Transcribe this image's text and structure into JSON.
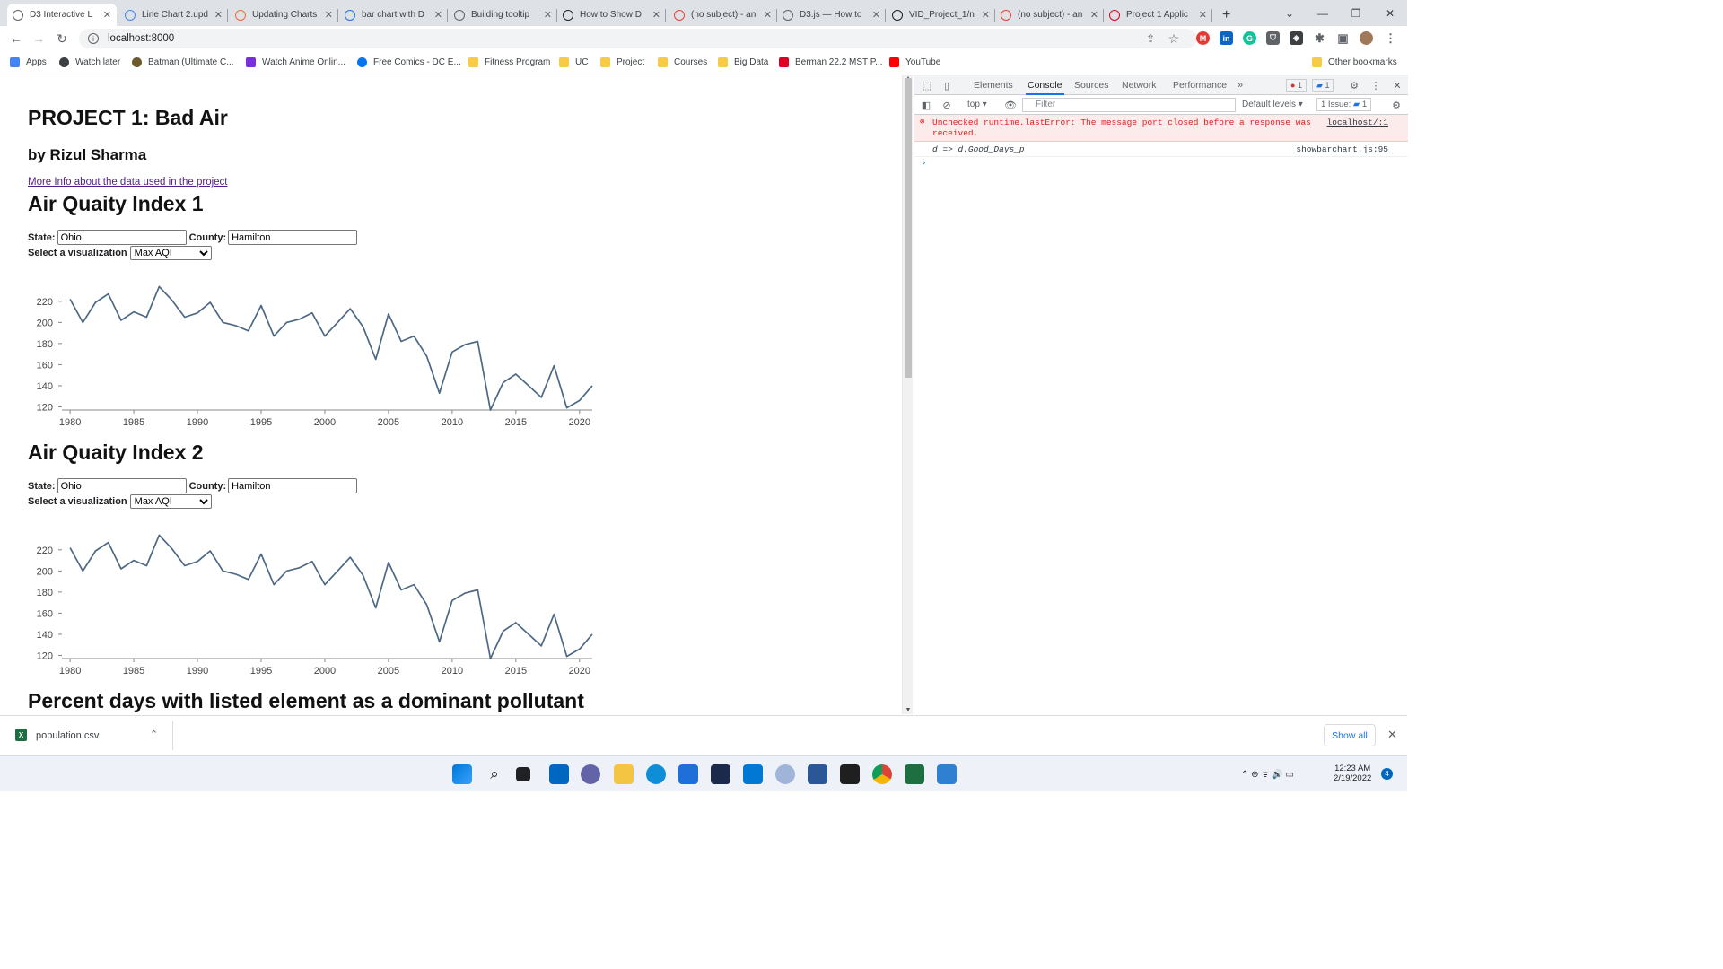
{
  "tabs": [
    {
      "title": "D3 Interactive L",
      "active": true,
      "icon": "globe-icon",
      "color": "#5f6368"
    },
    {
      "title": "Line Chart 2.upd",
      "icon": "google-icon",
      "color": "#4285f4"
    },
    {
      "title": "Updating Charts",
      "icon": "d3-icon",
      "color": "#f26b3a"
    },
    {
      "title": "bar chart with D",
      "icon": "cloud-icon",
      "color": "#1a73e8"
    },
    {
      "title": "Building tooltip",
      "icon": "tooltip-icon",
      "color": "#5f6368"
    },
    {
      "title": "How to Show D",
      "icon": "medium-icon",
      "color": "#202124"
    },
    {
      "title": "(no subject) - an",
      "icon": "gmail-icon",
      "color": "#ea4335"
    },
    {
      "title": "D3.js — How to",
      "icon": "globe-icon",
      "color": "#5f6368"
    },
    {
      "title": "VID_Project_1/n",
      "icon": "github-icon",
      "color": "#202124"
    },
    {
      "title": "(no subject) - an",
      "icon": "gmail-icon",
      "color": "#ea4335"
    },
    {
      "title": "Project 1 Applic",
      "icon": "uc-icon",
      "color": "#e00122"
    }
  ],
  "url": "localhost:8000",
  "bookmarks": [
    {
      "label": "Apps",
      "icon": "apps-icon"
    },
    {
      "label": "Watch later",
      "icon": "clock-icon"
    },
    {
      "label": "Batman (Ultimate C...",
      "icon": "batman-icon"
    },
    {
      "label": "Watch Anime Onlin...",
      "icon": "play-icon"
    },
    {
      "label": "Free Comics - DC E...",
      "icon": "dc-icon"
    },
    {
      "label": "Fitness Program",
      "icon": "folder-icon"
    },
    {
      "label": "UC",
      "icon": "folder-icon"
    },
    {
      "label": "Project",
      "icon": "folder-icon"
    },
    {
      "label": "Courses",
      "icon": "folder-icon"
    },
    {
      "label": "Big Data",
      "icon": "folder-icon"
    },
    {
      "label": "Berman 22.2 MST P...",
      "icon": "uc-icon"
    },
    {
      "label": "YouTube",
      "icon": "youtube-icon"
    }
  ],
  "other_bookmarks": "Other bookmarks",
  "page": {
    "title": "PROJECT 1: Bad Air",
    "author": "by Rizul Sharma",
    "more_link": "More Info about the data used in the project",
    "section1": "Air Quaity Index 1",
    "section2": "Air Quaity Index 2",
    "section3": "Percent days with listed element as a dominant pollutant",
    "state_label": "State:",
    "county_label": "County:",
    "state_value": "Ohio",
    "county_value": "Hamilton",
    "viz_label": "Select a visualization",
    "viz_selected": "Max AQI"
  },
  "chart_data": [
    {
      "type": "line",
      "x": [
        1980,
        1981,
        1982,
        1983,
        1984,
        1985,
        1986,
        1987,
        1988,
        1989,
        1990,
        1991,
        1992,
        1993,
        1994,
        1995,
        1996,
        1997,
        1998,
        1999,
        2000,
        2001,
        2002,
        2003,
        2004,
        2005,
        2006,
        2007,
        2008,
        2009,
        2010,
        2011,
        2012,
        2013,
        2014,
        2015,
        2016,
        2017,
        2018,
        2019,
        2020,
        2021
      ],
      "y": [
        222,
        200,
        219,
        227,
        202,
        210,
        205,
        234,
        221,
        205,
        209,
        219,
        200,
        197,
        192,
        216,
        187,
        200,
        203,
        209,
        187,
        200,
        213,
        196,
        165,
        208,
        182,
        187,
        168,
        133,
        172,
        179,
        182,
        117,
        143,
        151,
        140,
        129,
        159,
        119,
        126,
        140
      ],
      "xlim": [
        1979.5,
        2021
      ],
      "ylim": [
        117,
        236
      ],
      "yticks": [
        120,
        140,
        160,
        180,
        200,
        220
      ],
      "xticks": [
        1980,
        1985,
        1990,
        1995,
        2000,
        2005,
        2010,
        2015,
        2020
      ],
      "color": "#4c6884"
    },
    {
      "type": "line",
      "x": [
        1980,
        1981,
        1982,
        1983,
        1984,
        1985,
        1986,
        1987,
        1988,
        1989,
        1990,
        1991,
        1992,
        1993,
        1994,
        1995,
        1996,
        1997,
        1998,
        1999,
        2000,
        2001,
        2002,
        2003,
        2004,
        2005,
        2006,
        2007,
        2008,
        2009,
        2010,
        2011,
        2012,
        2013,
        2014,
        2015,
        2016,
        2017,
        2018,
        2019,
        2020,
        2021
      ],
      "y": [
        222,
        200,
        219,
        227,
        202,
        210,
        205,
        234,
        221,
        205,
        209,
        219,
        200,
        197,
        192,
        216,
        187,
        200,
        203,
        209,
        187,
        200,
        213,
        196,
        165,
        208,
        182,
        187,
        168,
        133,
        172,
        179,
        182,
        117,
        143,
        151,
        140,
        129,
        159,
        119,
        126,
        140
      ],
      "xlim": [
        1979.5,
        2021
      ],
      "ylim": [
        117,
        236
      ],
      "yticks": [
        120,
        140,
        160,
        180,
        200,
        220
      ],
      "xticks": [
        1980,
        1985,
        1990,
        1995,
        2000,
        2005,
        2010,
        2015,
        2020
      ],
      "color": "#4c6884"
    }
  ],
  "devtools": {
    "tabs": [
      "Elements",
      "Console",
      "Sources",
      "Network",
      "Performance"
    ],
    "active_tab": "Console",
    "context": "top",
    "filter_placeholder": "Filter",
    "levels": "Default levels",
    "issues": "1 Issue:",
    "issues_count": "1",
    "error_count": "1",
    "msg_count": "1",
    "error_text_1": "Unchecked runtime.lastError: The message port closed before a response was",
    "error_text_2": "received.",
    "error_source": "localhost/:1",
    "log_text": "d => d.Good_Days_p",
    "log_source": "showbarchart.js:95"
  },
  "download": {
    "file": "population.csv",
    "show_all": "Show all"
  },
  "clock": {
    "time": "12:23 AM",
    "date": "2/19/2022",
    "badge": "4"
  }
}
